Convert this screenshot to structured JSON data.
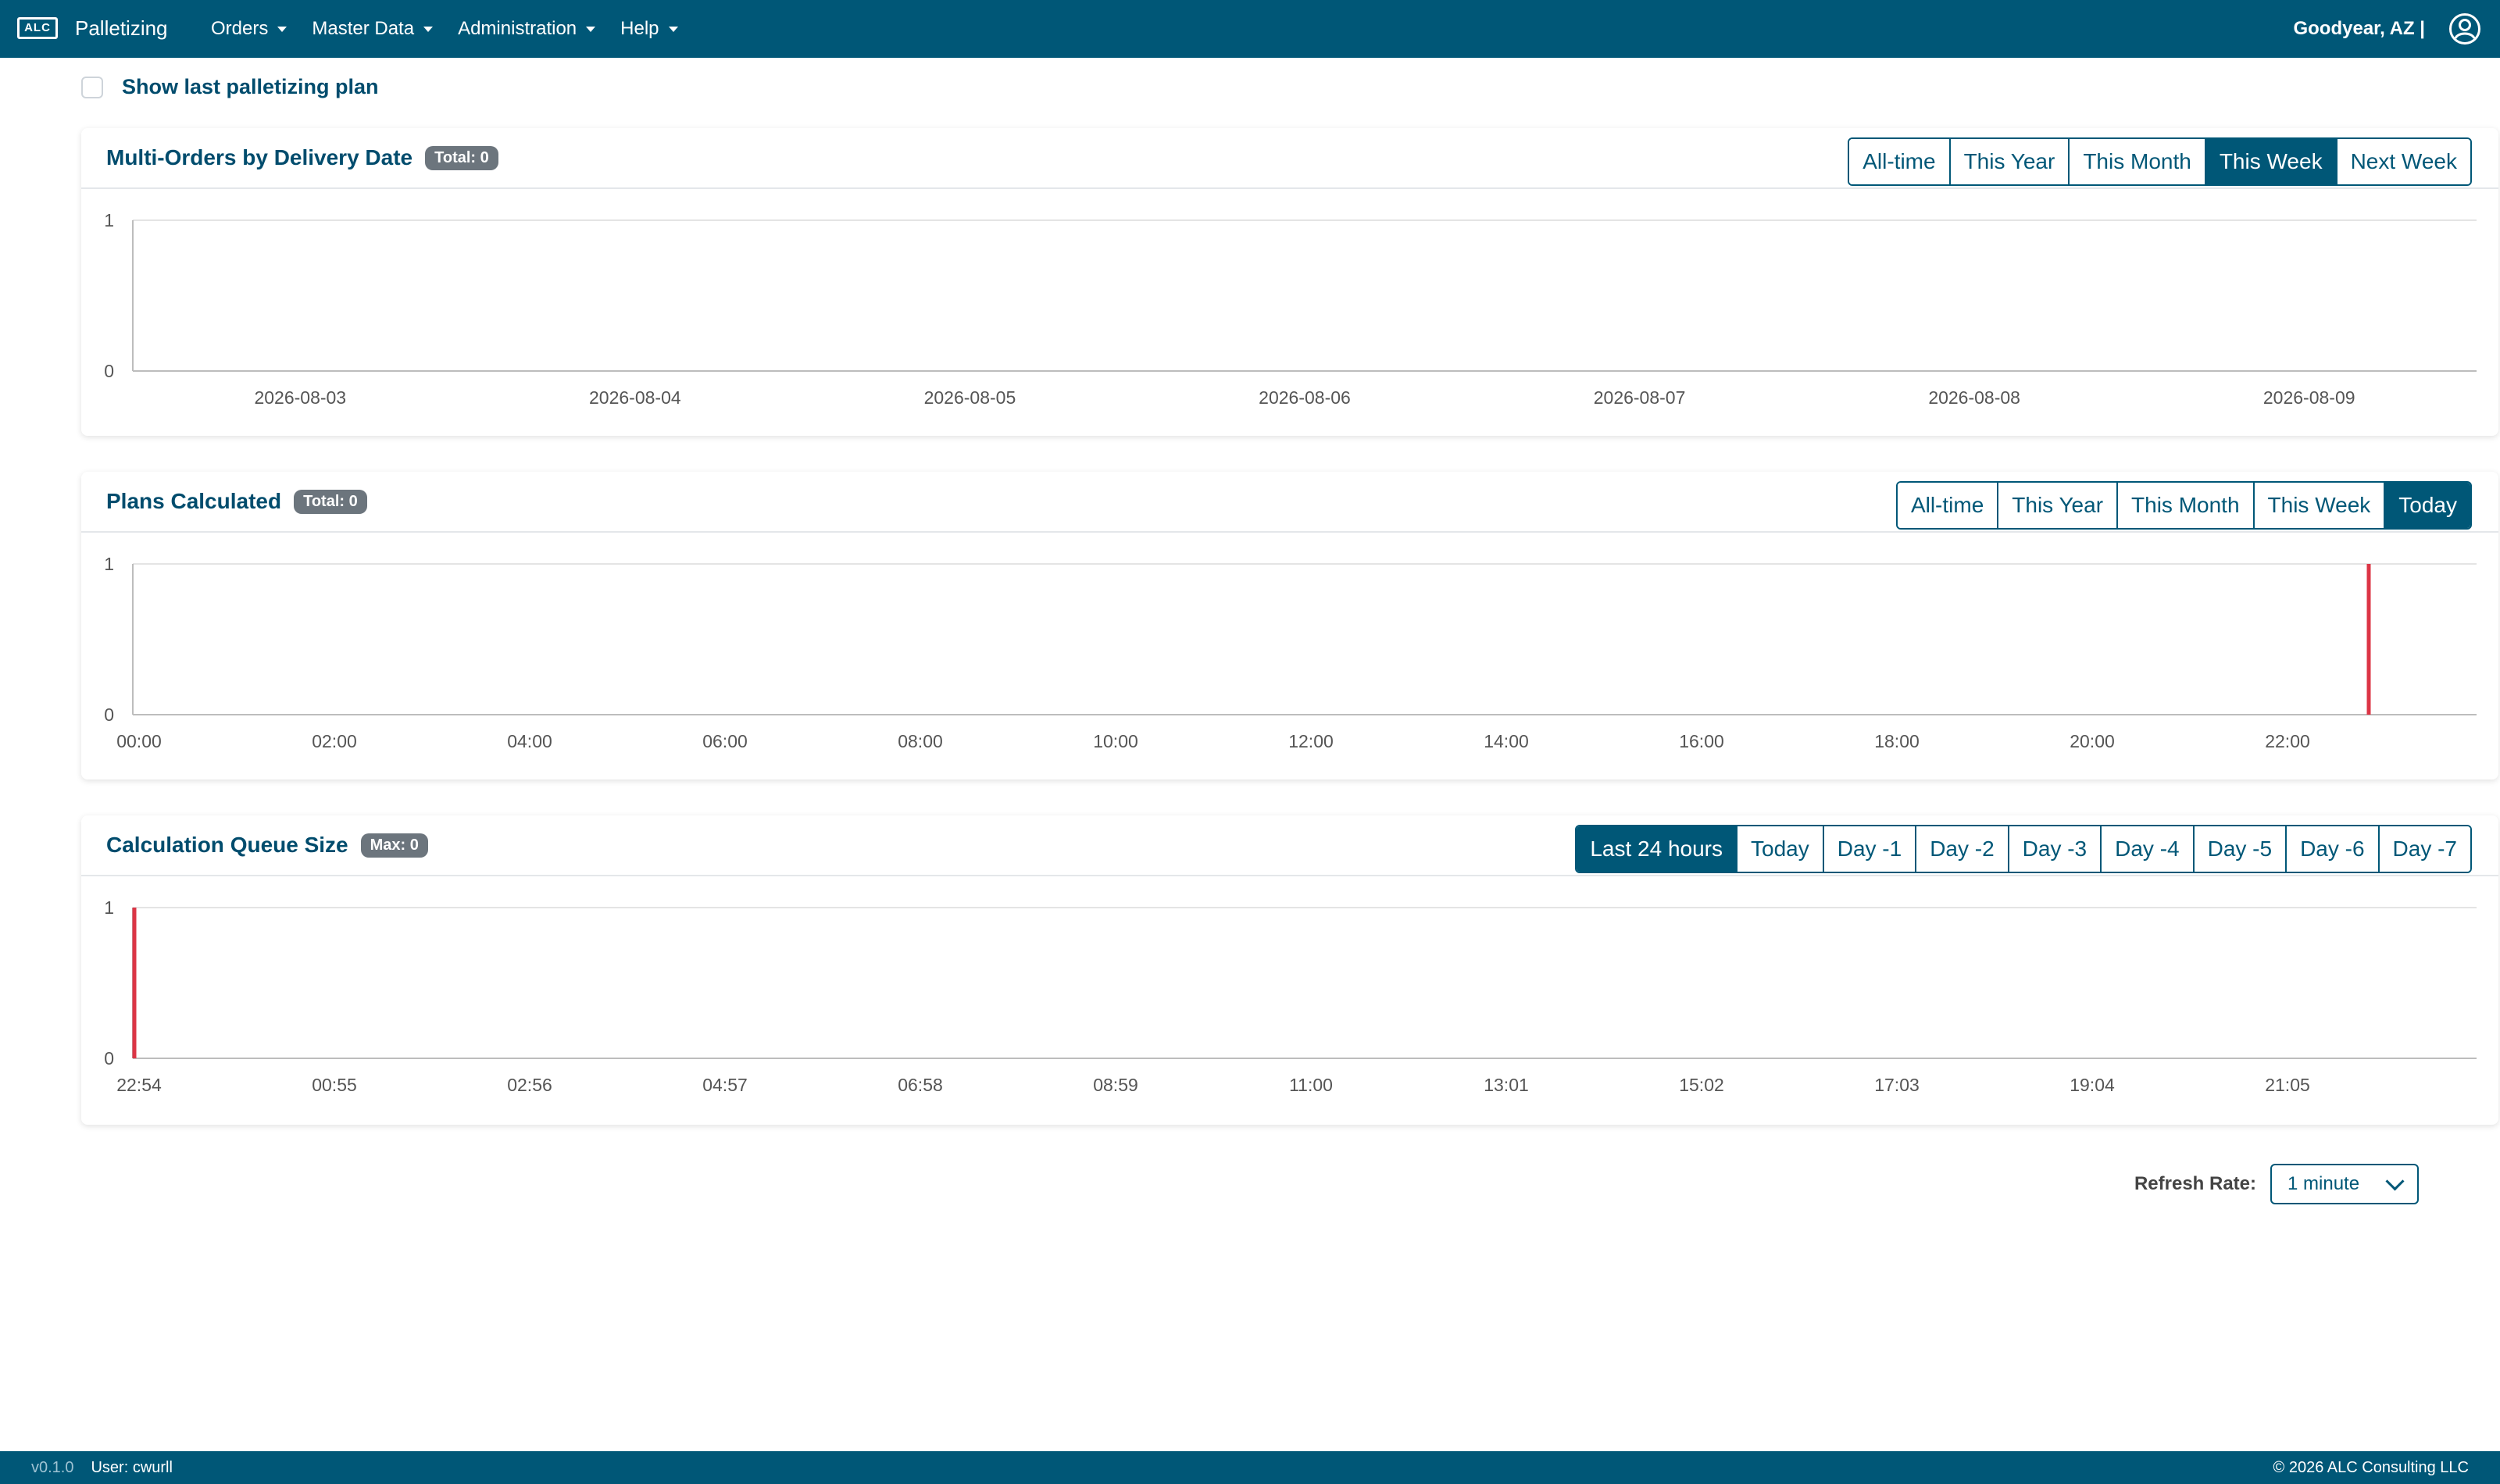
{
  "navbar": {
    "logo_text": "ALC",
    "brand": "Palletizing",
    "menu": [
      "Orders",
      "Master Data",
      "Administration",
      "Help"
    ],
    "location": "Goodyear, AZ |"
  },
  "show_last": {
    "label": "Show last palletizing plan",
    "checked": false
  },
  "cards": [
    {
      "title": "Multi-Orders by Delivery Date",
      "badge": "Total: 0",
      "buttons": [
        "All-time",
        "This Year",
        "This Month",
        "This Week",
        "Next Week"
      ],
      "active_button": "This Week"
    },
    {
      "title": "Plans Calculated",
      "badge": "Total: 0",
      "buttons": [
        "All-time",
        "This Year",
        "This Month",
        "This Week",
        "Today"
      ],
      "active_button": "Today"
    },
    {
      "title": "Calculation Queue Size",
      "badge": "Max: 0",
      "buttons": [
        "Last 24 hours",
        "Today",
        "Day -1",
        "Day -2",
        "Day -3",
        "Day -4",
        "Day -5",
        "Day -6",
        "Day -7"
      ],
      "active_button": "Last 24 hours"
    }
  ],
  "chart_data": [
    {
      "type": "bar",
      "categories": [
        "2026-08-03",
        "2026-08-04",
        "2026-08-05",
        "2026-08-06",
        "2026-08-07",
        "2026-08-08",
        "2026-08-09"
      ],
      "values": [
        0,
        0,
        0,
        0,
        0,
        0,
        0
      ],
      "yticks": [
        "1",
        "0"
      ],
      "ylim": [
        0,
        1
      ],
      "grid": true,
      "marker_index": null
    },
    {
      "type": "line",
      "categories": [
        "00:00",
        "02:00",
        "04:00",
        "06:00",
        "08:00",
        "10:00",
        "12:00",
        "14:00",
        "16:00",
        "18:00",
        "20:00",
        "22:00"
      ],
      "values": [
        0,
        0,
        0,
        0,
        0,
        0,
        0,
        0,
        0,
        0,
        0,
        0
      ],
      "yticks": [
        "1",
        "0"
      ],
      "ylim": [
        0,
        1
      ],
      "grid": true,
      "marker_position": 0.954,
      "marker_color": "#dc3545"
    },
    {
      "type": "line",
      "categories": [
        "22:54",
        "00:55",
        "02:56",
        "04:57",
        "06:58",
        "08:59",
        "11:00",
        "13:01",
        "15:02",
        "17:03",
        "19:04",
        "21:05"
      ],
      "values": [
        0,
        0,
        0,
        0,
        0,
        0,
        0,
        0,
        0,
        0,
        0,
        0
      ],
      "yticks": [
        "1",
        "0"
      ],
      "ylim": [
        0,
        1
      ],
      "grid": true,
      "marker_position": 0.0,
      "marker_color": "#dc3545"
    }
  ],
  "refresh": {
    "label": "Refresh Rate:",
    "value": "1 minute"
  },
  "footer": {
    "version": "v0.1.0",
    "user": "User: cwurll",
    "copyright": "© 2026 ALC Consulting LLC"
  },
  "colors": {
    "primary": "#005777",
    "marker": "#dc3545",
    "badge": "#6c757d"
  }
}
